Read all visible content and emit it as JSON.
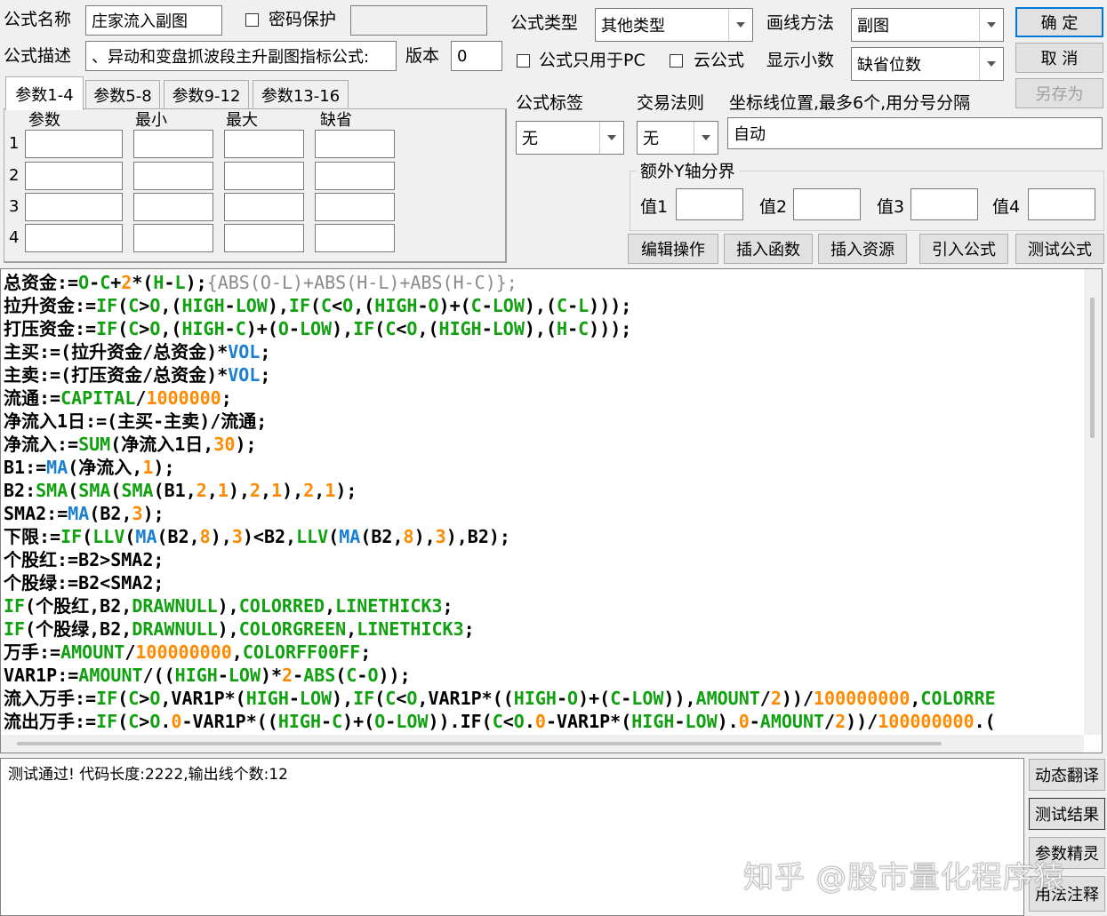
{
  "colors": {
    "keyword_green": "#10a010",
    "func_blue": "#1a7fd0",
    "number_orange": "#ff8a00",
    "comment_gray": "#8a8a8a",
    "text_black": "#000000"
  },
  "header": {
    "name_label": "公式名称",
    "name_value": "庄家流入副图",
    "password_label": "密码保护",
    "desc_label": "公式描述",
    "desc_value": "、异动和变盘抓波段主升副图指标公式:",
    "version_label": "版本",
    "version_value": "0",
    "type_label": "公式类型",
    "type_value": "其他类型",
    "draw_label": "画线方法",
    "draw_value": "副图",
    "pc_only_label": "公式只用于PC",
    "cloud_label": "云公式",
    "decimals_label": "显示小数",
    "decimals_value": "缺省位数"
  },
  "buttons": {
    "ok": "确  定",
    "cancel": "取  消",
    "save_as": "另存为",
    "edit_ops": "编辑操作",
    "insert_func": "插入函数",
    "insert_res": "插入资源",
    "import_formula": "引入公式",
    "test_formula": "测试公式",
    "dyn_translate": "动态翻译",
    "test_result": "测试结果",
    "param_wizard": "参数精灵",
    "usage_notes": "用法注释"
  },
  "tabs": [
    "参数1-4",
    "参数5-8",
    "参数9-12",
    "参数13-16"
  ],
  "params": {
    "headers": [
      "参数",
      "最小",
      "最大",
      "缺省"
    ],
    "rows": [
      "1",
      "2",
      "3",
      "4"
    ]
  },
  "settings": {
    "tag_label": "公式标签",
    "tag_value": "无",
    "rule_label": "交易法则",
    "rule_value": "无",
    "axis_label": "坐标线位置,最多6个,用分号分隔",
    "axis_value": "自动",
    "yaxis_group": "额外Y轴分界",
    "v1": "值1",
    "v2": "值2",
    "v3": "值3",
    "v4": "值4"
  },
  "code_lines": [
    [
      [
        "t",
        "总资金:="
      ],
      [
        "k",
        "O"
      ],
      [
        "t",
        "-"
      ],
      [
        "k",
        "C"
      ],
      [
        "t",
        "+"
      ],
      [
        "n",
        "2"
      ],
      [
        "t",
        "*("
      ],
      [
        "k",
        "H"
      ],
      [
        "t",
        "-"
      ],
      [
        "k",
        "L"
      ],
      [
        "t",
        ");"
      ],
      [
        "c",
        "{ABS(O-L)+ABS(H-L)+ABS(H-C)};"
      ]
    ],
    [
      [
        "t",
        "拉升资金:="
      ],
      [
        "k",
        "IF"
      ],
      [
        "t",
        "("
      ],
      [
        "k",
        "C"
      ],
      [
        "t",
        ">"
      ],
      [
        "k",
        "O"
      ],
      [
        "t",
        ",("
      ],
      [
        "k",
        "HIGH"
      ],
      [
        "t",
        "-"
      ],
      [
        "k",
        "LOW"
      ],
      [
        "t",
        "),"
      ],
      [
        "k",
        "IF"
      ],
      [
        "t",
        "("
      ],
      [
        "k",
        "C"
      ],
      [
        "t",
        "<"
      ],
      [
        "k",
        "O"
      ],
      [
        "t",
        ",("
      ],
      [
        "k",
        "HIGH"
      ],
      [
        "t",
        "-"
      ],
      [
        "k",
        "O"
      ],
      [
        "t",
        ")+("
      ],
      [
        "k",
        "C"
      ],
      [
        "t",
        "-"
      ],
      [
        "k",
        "LOW"
      ],
      [
        "t",
        "),("
      ],
      [
        "k",
        "C"
      ],
      [
        "t",
        "-"
      ],
      [
        "k",
        "L"
      ],
      [
        "t",
        ")));"
      ]
    ],
    [
      [
        "t",
        "打压资金:="
      ],
      [
        "k",
        "IF"
      ],
      [
        "t",
        "("
      ],
      [
        "k",
        "C"
      ],
      [
        "t",
        ">"
      ],
      [
        "k",
        "O"
      ],
      [
        "t",
        ",("
      ],
      [
        "k",
        "HIGH"
      ],
      [
        "t",
        "-"
      ],
      [
        "k",
        "C"
      ],
      [
        "t",
        ")+("
      ],
      [
        "k",
        "O"
      ],
      [
        "t",
        "-"
      ],
      [
        "k",
        "LOW"
      ],
      [
        "t",
        "),"
      ],
      [
        "k",
        "IF"
      ],
      [
        "t",
        "("
      ],
      [
        "k",
        "C"
      ],
      [
        "t",
        "<"
      ],
      [
        "k",
        "O"
      ],
      [
        "t",
        ",("
      ],
      [
        "k",
        "HIGH"
      ],
      [
        "t",
        "-"
      ],
      [
        "k",
        "LOW"
      ],
      [
        "t",
        "),("
      ],
      [
        "k",
        "H"
      ],
      [
        "t",
        "-"
      ],
      [
        "k",
        "C"
      ],
      [
        "t",
        ")));"
      ]
    ],
    [
      [
        "t",
        "主买:=(拉升资金/总资金)*"
      ],
      [
        "f",
        "VOL"
      ],
      [
        "t",
        ";"
      ]
    ],
    [
      [
        "t",
        "主卖:=(打压资金/总资金)*"
      ],
      [
        "f",
        "VOL"
      ],
      [
        "t",
        ";"
      ]
    ],
    [
      [
        "t",
        "流通:="
      ],
      [
        "k",
        "CAPITAL"
      ],
      [
        "t",
        "/"
      ],
      [
        "n",
        "1000000"
      ],
      [
        "t",
        ";"
      ]
    ],
    [
      [
        "t",
        "净流入1日:=(主买-主卖)/流通;"
      ]
    ],
    [
      [
        "t",
        "净流入:="
      ],
      [
        "k",
        "SUM"
      ],
      [
        "t",
        "(净流入1日,"
      ],
      [
        "n",
        "30"
      ],
      [
        "t",
        ");"
      ]
    ],
    [
      [
        "t",
        "B1:="
      ],
      [
        "f",
        "MA"
      ],
      [
        "t",
        "(净流入,"
      ],
      [
        "n",
        "1"
      ],
      [
        "t",
        ");"
      ]
    ],
    [
      [
        "t",
        "B2:"
      ],
      [
        "k",
        "SMA"
      ],
      [
        "t",
        "("
      ],
      [
        "k",
        "SMA"
      ],
      [
        "t",
        "("
      ],
      [
        "k",
        "SMA"
      ],
      [
        "t",
        "(B1,"
      ],
      [
        "n",
        "2"
      ],
      [
        "t",
        ","
      ],
      [
        "n",
        "1"
      ],
      [
        "t",
        "),"
      ],
      [
        "n",
        "2"
      ],
      [
        "t",
        ","
      ],
      [
        "n",
        "1"
      ],
      [
        "t",
        "),"
      ],
      [
        "n",
        "2"
      ],
      [
        "t",
        ","
      ],
      [
        "n",
        "1"
      ],
      [
        "t",
        ");"
      ]
    ],
    [
      [
        "t",
        "SMA2:="
      ],
      [
        "f",
        "MA"
      ],
      [
        "t",
        "(B2,"
      ],
      [
        "n",
        "3"
      ],
      [
        "t",
        ");"
      ]
    ],
    [
      [
        "t",
        "下限:="
      ],
      [
        "k",
        "IF"
      ],
      [
        "t",
        "("
      ],
      [
        "k",
        "LLV"
      ],
      [
        "t",
        "("
      ],
      [
        "f",
        "MA"
      ],
      [
        "t",
        "(B2,"
      ],
      [
        "n",
        "8"
      ],
      [
        "t",
        "),"
      ],
      [
        "n",
        "3"
      ],
      [
        "t",
        ")<B2,"
      ],
      [
        "k",
        "LLV"
      ],
      [
        "t",
        "("
      ],
      [
        "f",
        "MA"
      ],
      [
        "t",
        "(B2,"
      ],
      [
        "n",
        "8"
      ],
      [
        "t",
        "),"
      ],
      [
        "n",
        "3"
      ],
      [
        "t",
        "),B2);"
      ]
    ],
    [
      [
        "t",
        "个股红:=B2>SMA2;"
      ]
    ],
    [
      [
        "t",
        "个股绿:=B2<SMA2;"
      ]
    ],
    [
      [
        "k",
        "IF"
      ],
      [
        "t",
        "(个股红,B2,"
      ],
      [
        "k",
        "DRAWNULL"
      ],
      [
        "t",
        "),"
      ],
      [
        "k",
        "COLORRED"
      ],
      [
        "t",
        ","
      ],
      [
        "k",
        "LINETHICK3"
      ],
      [
        "t",
        ";"
      ]
    ],
    [
      [
        "k",
        "IF"
      ],
      [
        "t",
        "(个股绿,B2,"
      ],
      [
        "k",
        "DRAWNULL"
      ],
      [
        "t",
        "),"
      ],
      [
        "k",
        "COLORGREEN"
      ],
      [
        "t",
        ","
      ],
      [
        "k",
        "LINETHICK3"
      ],
      [
        "t",
        ";"
      ]
    ],
    [
      [
        "t",
        "万手:="
      ],
      [
        "k",
        "AMOUNT"
      ],
      [
        "t",
        "/"
      ],
      [
        "n",
        "100000000"
      ],
      [
        "t",
        ","
      ],
      [
        "k",
        "COLORFF00FF"
      ],
      [
        "t",
        ";"
      ]
    ],
    [
      [
        "t",
        "VAR1P:="
      ],
      [
        "k",
        "AMOUNT"
      ],
      [
        "t",
        "/(("
      ],
      [
        "k",
        "HIGH"
      ],
      [
        "t",
        "-"
      ],
      [
        "k",
        "LOW"
      ],
      [
        "t",
        ")*"
      ],
      [
        "n",
        "2"
      ],
      [
        "t",
        "-"
      ],
      [
        "k",
        "ABS"
      ],
      [
        "t",
        "("
      ],
      [
        "k",
        "C"
      ],
      [
        "t",
        "-"
      ],
      [
        "k",
        "O"
      ],
      [
        "t",
        "));"
      ]
    ],
    [
      [
        "t",
        "流入万手:="
      ],
      [
        "k",
        "IF"
      ],
      [
        "t",
        "("
      ],
      [
        "k",
        "C"
      ],
      [
        "t",
        ">"
      ],
      [
        "k",
        "O"
      ],
      [
        "t",
        ",VAR1P*("
      ],
      [
        "k",
        "HIGH"
      ],
      [
        "t",
        "-"
      ],
      [
        "k",
        "LOW"
      ],
      [
        "t",
        "),"
      ],
      [
        "k",
        "IF"
      ],
      [
        "t",
        "("
      ],
      [
        "k",
        "C"
      ],
      [
        "t",
        "<"
      ],
      [
        "k",
        "O"
      ],
      [
        "t",
        ",VAR1P*(("
      ],
      [
        "k",
        "HIGH"
      ],
      [
        "t",
        "-"
      ],
      [
        "k",
        "O"
      ],
      [
        "t",
        ")+("
      ],
      [
        "k",
        "C"
      ],
      [
        "t",
        "-"
      ],
      [
        "k",
        "LOW"
      ],
      [
        "t",
        ")),"
      ],
      [
        "k",
        "AMOUNT"
      ],
      [
        "t",
        "/"
      ],
      [
        "n",
        "2"
      ],
      [
        "t",
        "))/"
      ],
      [
        "n",
        "100000000"
      ],
      [
        "t",
        ","
      ],
      [
        "k",
        "COLORRE"
      ]
    ],
    [
      [
        "t",
        "流出万手:="
      ],
      [
        "k",
        "IF"
      ],
      [
        "t",
        "("
      ],
      [
        "k",
        "C"
      ],
      [
        "t",
        ">"
      ],
      [
        "k",
        "O"
      ],
      [
        "t",
        "."
      ],
      [
        "n",
        "0"
      ],
      [
        "t",
        "-VAR1P*(("
      ],
      [
        "k",
        "HIGH"
      ],
      [
        "t",
        "-"
      ],
      [
        "k",
        "C"
      ],
      [
        "t",
        ")+("
      ],
      [
        "k",
        "O"
      ],
      [
        "t",
        "-"
      ],
      [
        "k",
        "LOW"
      ],
      [
        "t",
        ")).IF("
      ],
      [
        "k",
        "C"
      ],
      [
        "t",
        "<"
      ],
      [
        "k",
        "O"
      ],
      [
        "t",
        "."
      ],
      [
        "n",
        "0"
      ],
      [
        "t",
        "-VAR1P*("
      ],
      [
        "k",
        "HIGH"
      ],
      [
        "t",
        "-"
      ],
      [
        "k",
        "LOW"
      ],
      [
        "t",
        ")."
      ],
      [
        "n",
        "0"
      ],
      [
        "t",
        "-"
      ],
      [
        "k",
        "AMOUNT"
      ],
      [
        "t",
        "/"
      ],
      [
        "n",
        "2"
      ],
      [
        "t",
        "))/"
      ],
      [
        "n",
        "100000000"
      ],
      [
        "t",
        ".("
      ]
    ]
  ],
  "output": {
    "message": "测试通过! 代码长度:2222,输出线个数:12"
  },
  "watermark": "知乎 @股市量化程序猿"
}
